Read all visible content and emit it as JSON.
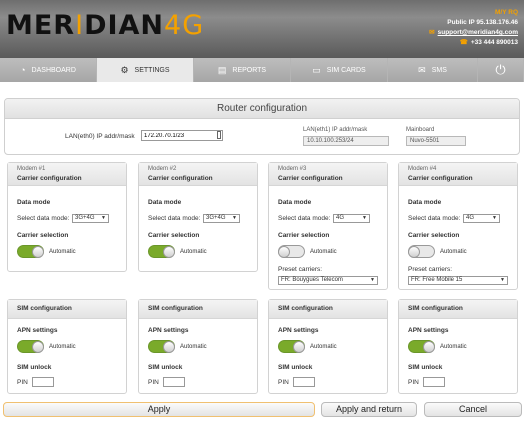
{
  "header": {
    "logo_main": "MER",
    "logo_i": "I",
    "logo_mid": "DIAN",
    "logo_4g": "4G",
    "vessel": "M/Y RQ",
    "public_ip": "Public IP 95.138.176.46",
    "email": "support@meridian4g.com",
    "phone": "+33 444 890013"
  },
  "nav": {
    "tabs": [
      {
        "label": "DASHBOARD",
        "icon": "dashboard-icon"
      },
      {
        "label": "SETTINGS",
        "icon": "settings-icon"
      },
      {
        "label": "REPORTS",
        "icon": "reports-icon"
      },
      {
        "label": "SIM CARDS",
        "icon": "sim-icon"
      },
      {
        "label": "SMS",
        "icon": "mail-icon"
      }
    ],
    "active": "SETTINGS",
    "power_icon": "power-icon"
  },
  "router": {
    "title": "Router configuration",
    "lan0_label": "LAN(eth0) IP addr/mask",
    "lan0_value": "172.20.70.1/23",
    "lan1_label": "LAN(eth1) IP addr/mask",
    "lan1_value": "10.10.100.253/24",
    "mainboard_label": "Mainboard",
    "mainboard_value": "Nuvo-5501"
  },
  "modems": [
    {
      "name": "Modem #1",
      "title": "Carrier configuration",
      "data_mode_label": "Data mode",
      "select_label": "Select data mode:",
      "select_value": "3G+4G",
      "carrier_label": "Carrier selection",
      "auto_label": "Automatic",
      "auto_on": true
    },
    {
      "name": "Modem #2",
      "title": "Carrier configuration",
      "data_mode_label": "Data mode",
      "select_label": "Select data mode:",
      "select_value": "3G+4G",
      "carrier_label": "Carrier selection",
      "auto_label": "Automatic",
      "auto_on": true
    },
    {
      "name": "Modem #3",
      "title": "Carrier configuration",
      "data_mode_label": "Data mode",
      "select_label": "Select data mode:",
      "select_value": "4G",
      "carrier_label": "Carrier selection",
      "auto_label": "Automatic",
      "auto_on": false,
      "preset_label": "Preset carriers:",
      "preset_value": "FR: Bouygues Telecom"
    },
    {
      "name": "Modem #4",
      "title": "Carrier configuration",
      "data_mode_label": "Data mode",
      "select_label": "Select data mode:",
      "select_value": "4G",
      "carrier_label": "Carrier selection",
      "auto_label": "Automatic",
      "auto_on": false,
      "preset_label": "Preset carriers:",
      "preset_value": "FR: Free Mobile 15"
    }
  ],
  "sims": [
    {
      "title": "SIM configuration",
      "apn_label": "APN settings",
      "auto_label": "Automatic",
      "unlock_label": "SIM unlock",
      "pin_label": "PIN"
    },
    {
      "title": "SIM configuration",
      "apn_label": "APN settings",
      "auto_label": "Automatic",
      "unlock_label": "SIM unlock",
      "pin_label": "PIN"
    },
    {
      "title": "SIM configuration",
      "apn_label": "APN settings",
      "auto_label": "Automatic",
      "unlock_label": "SIM unlock",
      "pin_label": "PIN"
    },
    {
      "title": "SIM configuration",
      "apn_label": "APN settings",
      "auto_label": "Automatic",
      "unlock_label": "SIM unlock",
      "pin_label": "PIN"
    }
  ],
  "buttons": {
    "apply": "Apply",
    "apply_return": "Apply and return",
    "cancel": "Cancel"
  },
  "colors": {
    "accent": "#f4a100",
    "toggle_on": "#7aaa2a"
  }
}
